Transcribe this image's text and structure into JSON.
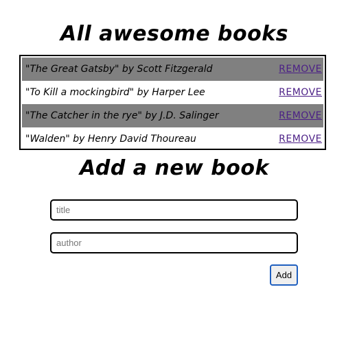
{
  "header": {
    "title": "All awesome books"
  },
  "books": [
    {
      "text": "\"The Great Gatsby\" by Scott Fitzgerald",
      "remove_label": "REMOVE"
    },
    {
      "text": "\"To Kill a mockingbird\" by Harper Lee",
      "remove_label": "REMOVE"
    },
    {
      "text": "\"The Catcher in the rye\" by J.D. Salinger",
      "remove_label": "REMOVE"
    },
    {
      "text": "\"Walden\" by Henry David Thoureau",
      "remove_label": "REMOVE"
    }
  ],
  "form": {
    "title": "Add a new book",
    "title_input": {
      "value": "",
      "placeholder": "title"
    },
    "author_input": {
      "value": "",
      "placeholder": "author"
    },
    "add_label": "Add"
  },
  "colors": {
    "row_alt_background": "#808080",
    "link": "#4b1f86",
    "button_border": "#1f5fbf"
  }
}
